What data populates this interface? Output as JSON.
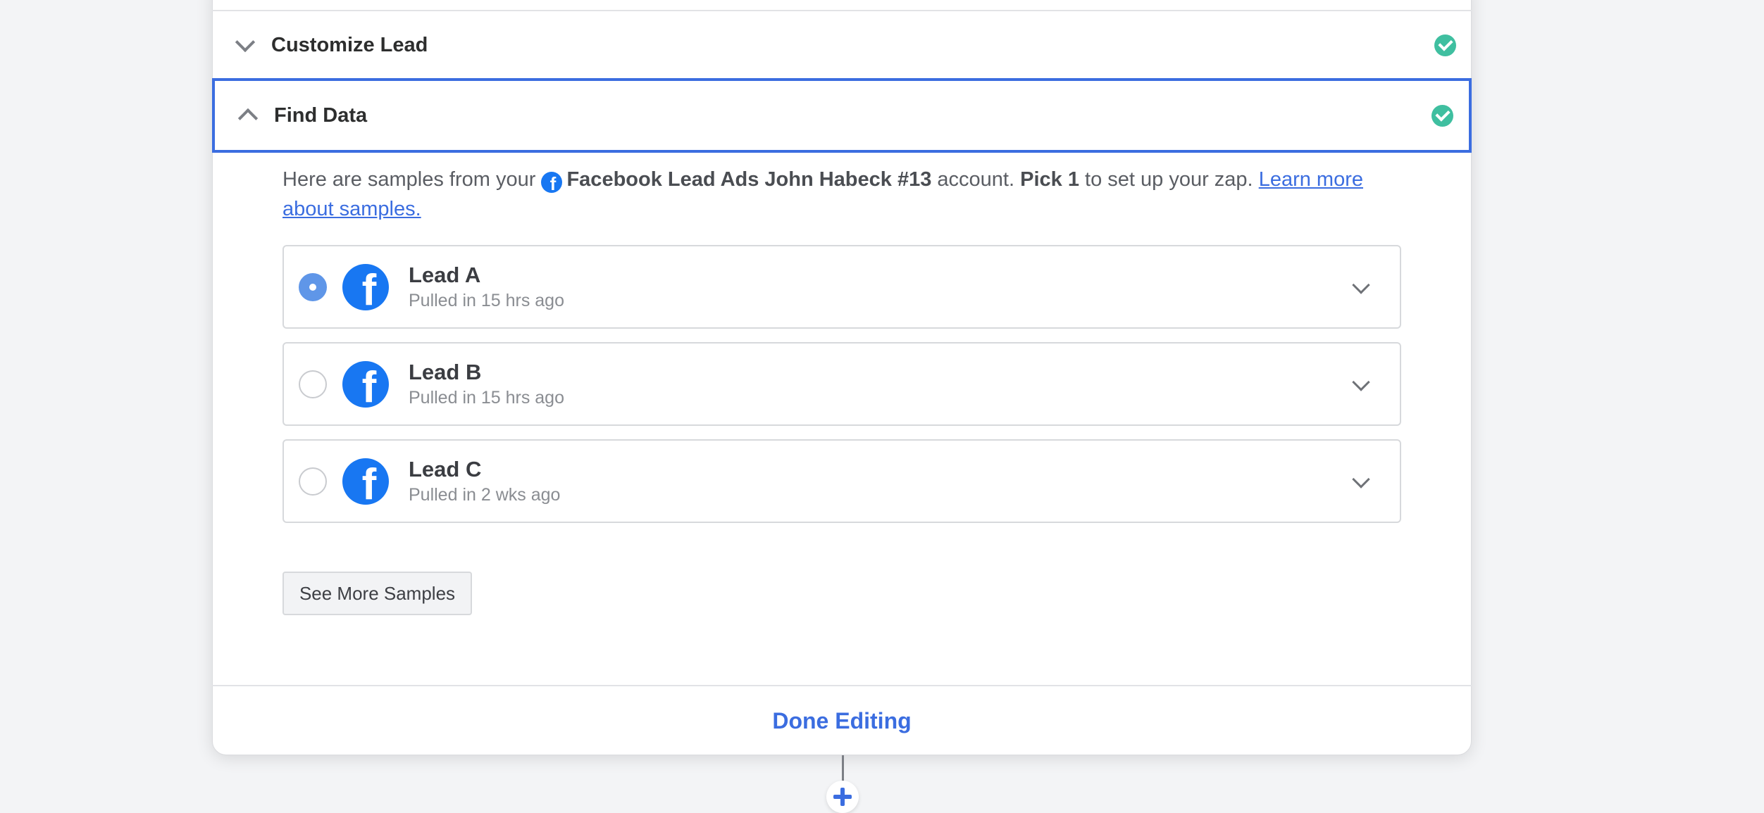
{
  "sections": {
    "customize": {
      "title": "Customize Lead",
      "status": "complete"
    },
    "find": {
      "title": "Find Data",
      "status": "complete"
    }
  },
  "intro": {
    "prefix": "Here are samples from your",
    "account": "Facebook Lead Ads John Habeck #13",
    "middle": "account.",
    "pick": "Pick 1",
    "suffix": "to set up your zap.",
    "link": "Learn more about samples."
  },
  "samples": [
    {
      "name": "Lead A",
      "pulled": "Pulled in 15 hrs ago",
      "selected": true
    },
    {
      "name": "Lead B",
      "pulled": "Pulled in 15 hrs ago",
      "selected": false
    },
    {
      "name": "Lead C",
      "pulled": "Pulled in 2 wks ago",
      "selected": false
    }
  ],
  "see_more_label": "See More Samples",
  "done_label": "Done Editing",
  "colors": {
    "accent": "#3b6de0",
    "success": "#3fbfa0",
    "facebook": "#1877f2"
  },
  "icons": {
    "fb": "f"
  }
}
